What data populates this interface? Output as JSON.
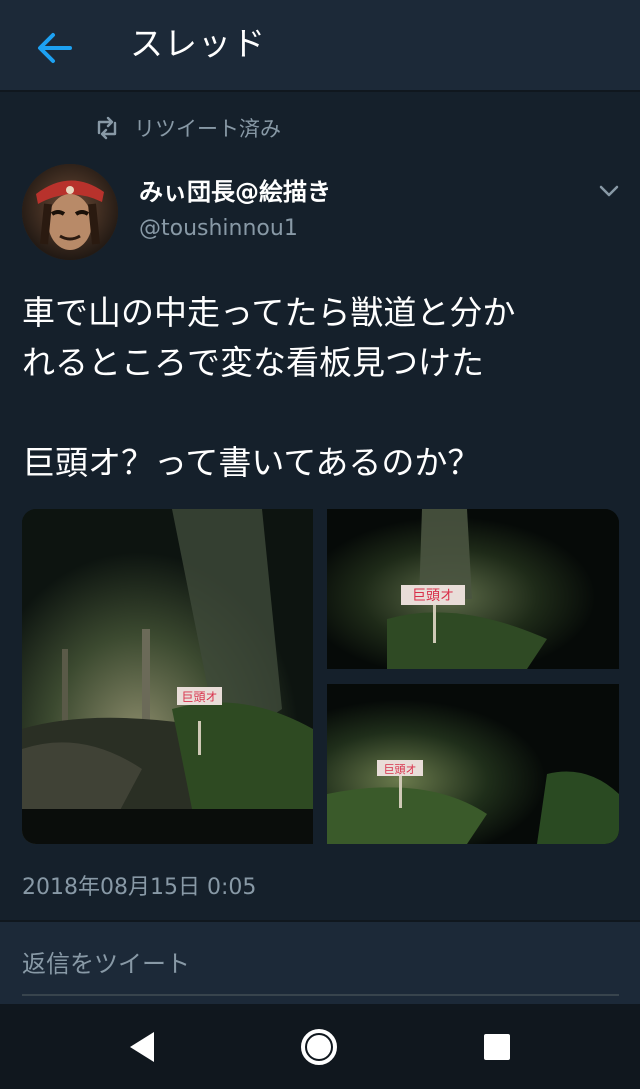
{
  "header": {
    "title": "スレッド",
    "back_icon": "arrow-left-icon"
  },
  "retweet": {
    "label": "リツイート済み",
    "icon": "retweet-icon"
  },
  "author": {
    "name": "みぃ団長@絵描き",
    "handle": "@toushinnou1",
    "menu_icon": "chevron-down-icon"
  },
  "tweet": {
    "line1": "車で山の中走ってたら獣道と分か",
    "line2": "れるところで変な看板見つけた",
    "line3": "巨頭オ？って書いてあるのか？"
  },
  "media": {
    "photos": [
      {
        "sign_text": "巨頭オ"
      },
      {
        "sign_text": "巨頭オ"
      },
      {
        "sign_text": "巨頭オ"
      }
    ]
  },
  "timestamp": "2018年08月15日 0:05",
  "reply": {
    "placeholder": "返信をツイート"
  },
  "navbar": {
    "back_icon": "triangle-back-icon",
    "home_icon": "circle-home-icon",
    "recents_icon": "square-recents-icon"
  },
  "colors": {
    "background": "#15202b",
    "header": "#1c2938",
    "accent": "#1da1f2",
    "secondary_text": "#8899a6",
    "sign_red": "#d9304a"
  }
}
